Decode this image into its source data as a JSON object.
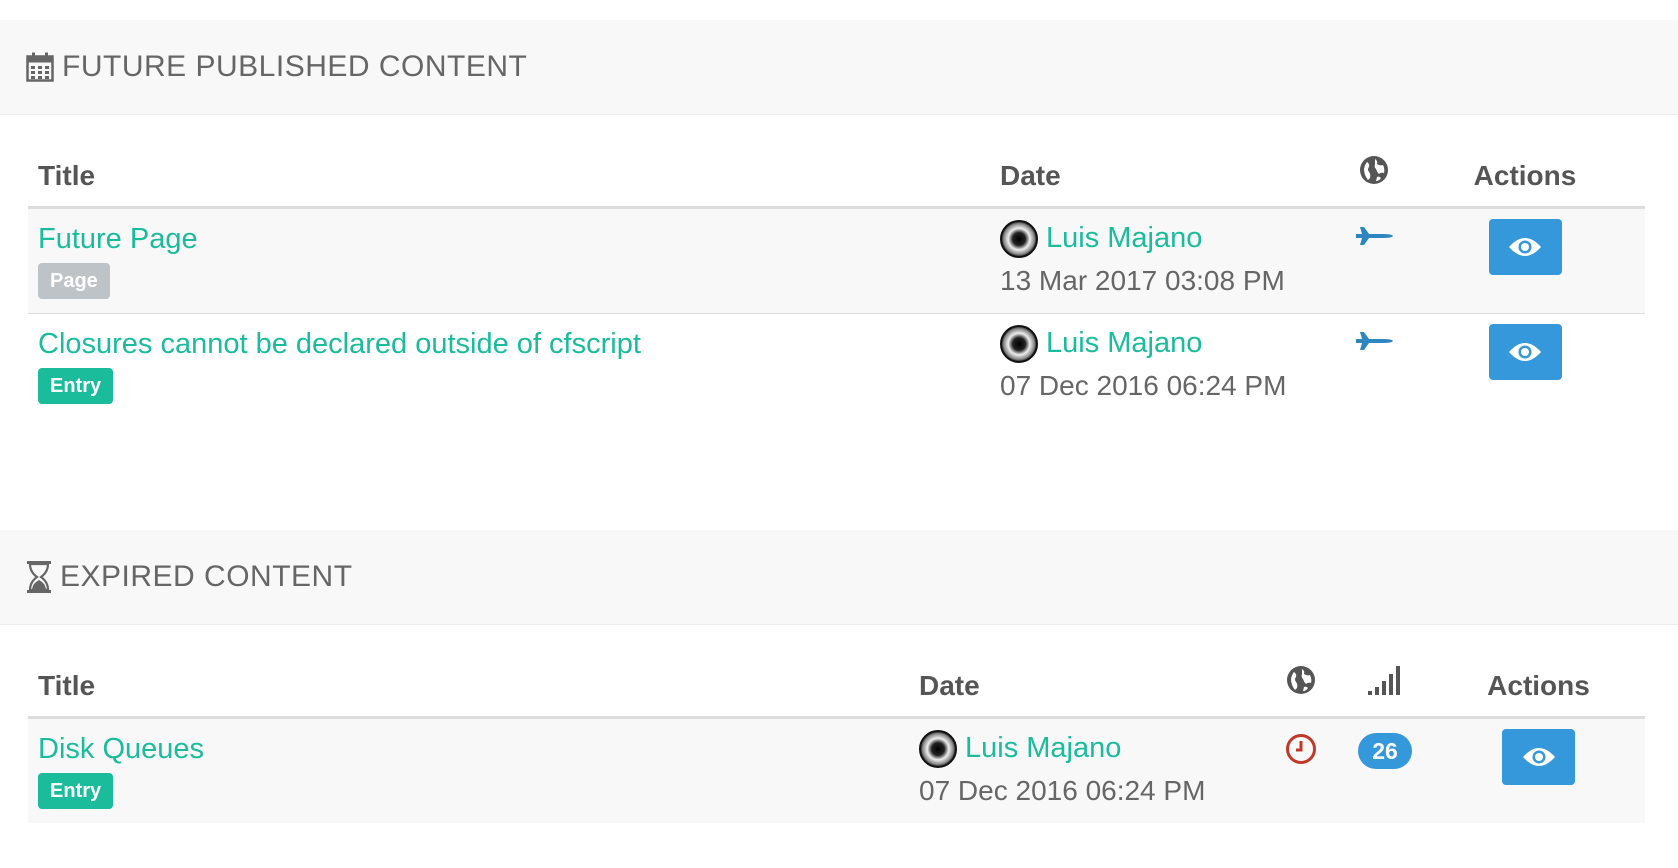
{
  "future_section": {
    "title": "FUTURE PUBLISHED CONTENT",
    "icon": "calendar-icon",
    "columns": {
      "title": "Title",
      "date": "Date",
      "actions": "Actions"
    },
    "rows": [
      {
        "title": "Future Page",
        "type": "Page",
        "author": "Luis Majano",
        "date": "13 Mar 2017 03:08 PM",
        "status_icon": "plane-icon"
      },
      {
        "title": "Closures cannot be declared outside of cfscript",
        "type": "Entry",
        "author": "Luis Majano",
        "date": "07 Dec 2016 06:24 PM",
        "status_icon": "plane-icon"
      }
    ]
  },
  "expired_section": {
    "title": "EXPIRED CONTENT",
    "icon": "hourglass-icon",
    "columns": {
      "title": "Title",
      "date": "Date",
      "actions": "Actions"
    },
    "rows": [
      {
        "title": "Disk Queues",
        "type": "Entry",
        "author": "Luis Majano",
        "date": "07 Dec 2016 06:24 PM",
        "status_icon": "clock-icon",
        "hits": "26"
      }
    ]
  },
  "colors": {
    "link": "#1abc9c",
    "primary": "#3498db",
    "badge_page": "#bdc3c7",
    "badge_entry": "#1abc9c",
    "expired": "#c0392b",
    "plane": "#2e86c1"
  }
}
